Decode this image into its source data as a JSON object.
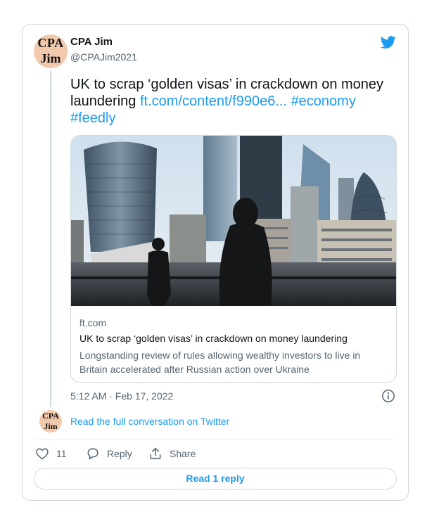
{
  "author": {
    "name": "CPA Jim",
    "handle": "@CPAJim2021",
    "avatar_line1": "CPA",
    "avatar_line2": "Jim"
  },
  "tweet": {
    "text": "UK to scrap ‘golden visas’ in crackdown on money laundering",
    "link": "ft.com/content/f990e6...",
    "hashtag1": "#economy",
    "hashtag2": "#feedly"
  },
  "link_card": {
    "domain": "ft.com",
    "title": "UK to scrap ‘golden visas’ in crackdown on money laundering",
    "description": "Longstanding review of rules allowing wealthy investors to live in Britain accelerated after Russian action over Ukraine"
  },
  "timestamp": "5:12 AM · Feb 17, 2022",
  "read_conversation": "Read the full conversation on Twitter",
  "actions": {
    "like_count": "11",
    "reply_label": "Reply",
    "share_label": "Share"
  },
  "read_replies_label": "Read 1 reply",
  "colors": {
    "accent": "#1d9bf0",
    "text": "#0f1419",
    "muted": "#536471",
    "border": "#cfd9de"
  },
  "icons": [
    "twitter-bird-icon",
    "info-icon",
    "heart-icon",
    "reply-bubble-icon",
    "share-icon"
  ]
}
